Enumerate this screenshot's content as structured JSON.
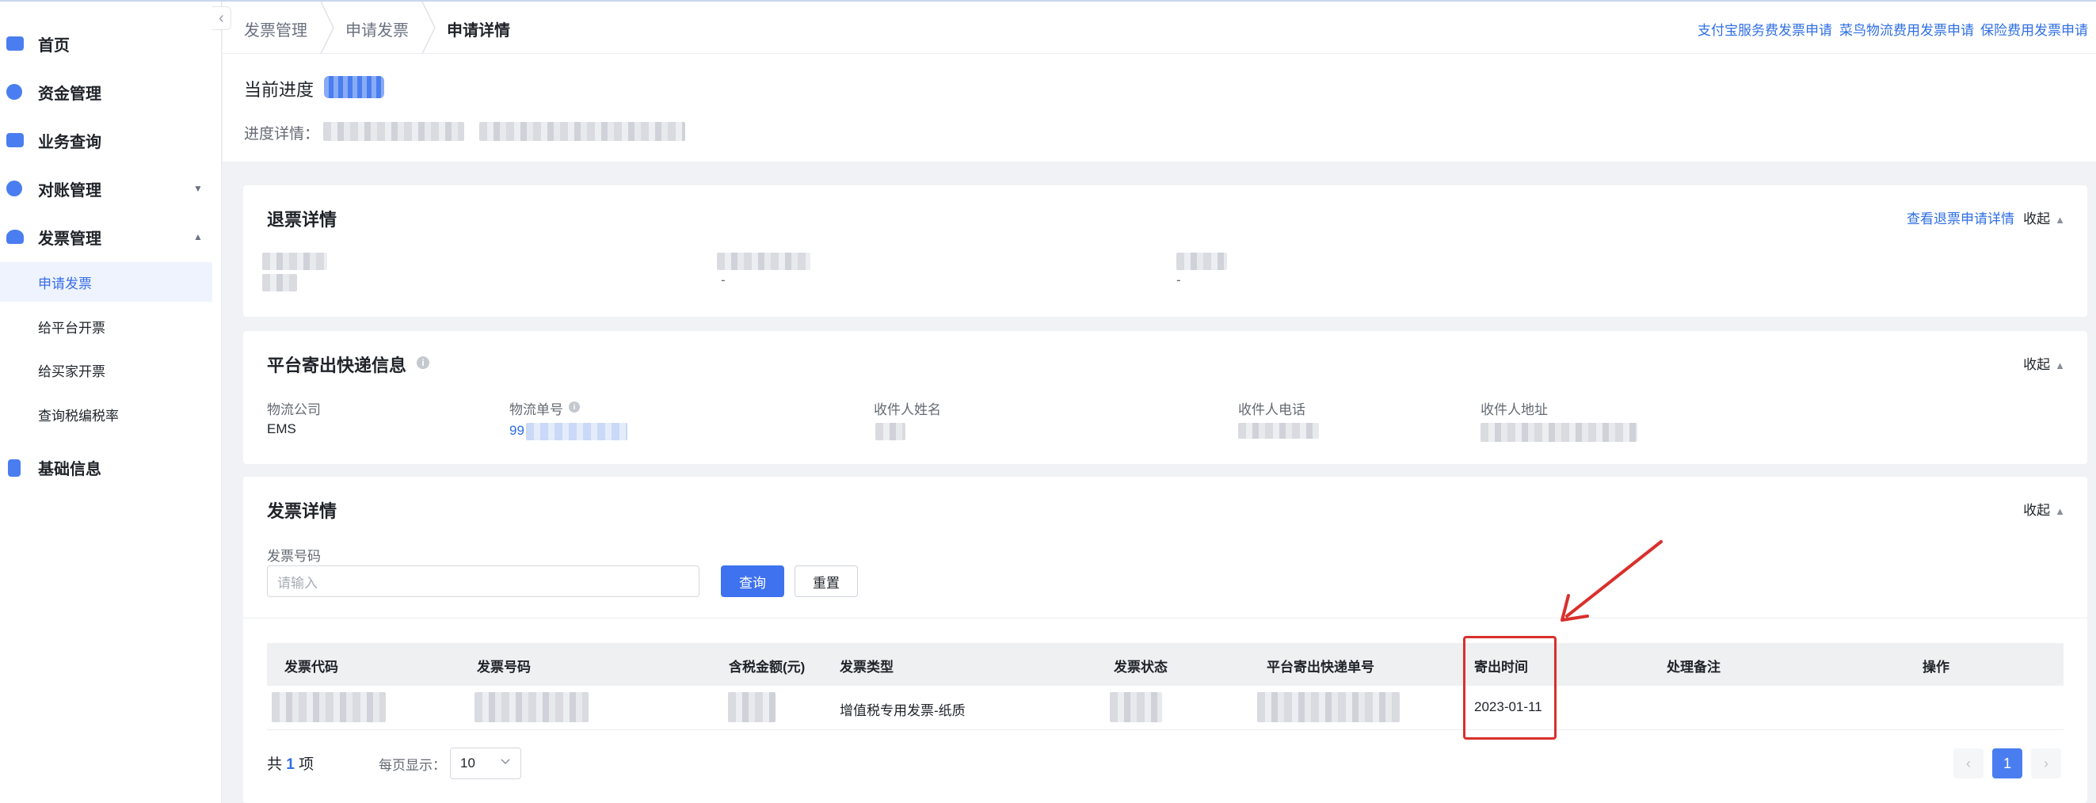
{
  "sidebar": {
    "collapse_glyph": "‹",
    "items": [
      {
        "label": "首页",
        "icon": "home-icon",
        "color": "#4a7ef0"
      },
      {
        "label": "资金管理",
        "icon": "money-icon",
        "color": "#4a7ef0"
      },
      {
        "label": "业务查询",
        "icon": "folder-icon",
        "color": "#4a7ef0"
      },
      {
        "label": "对账管理",
        "icon": "reconcile-icon",
        "color": "#4a7ef0",
        "arrow": "▼"
      },
      {
        "label": "发票管理",
        "icon": "invoice-icon",
        "color": "#4a7ef0",
        "arrow": "▲"
      }
    ],
    "sub_items": [
      "申请发票",
      "给平台开票",
      "给买家开票",
      "查询税编税率"
    ],
    "active_sub": "申请发票",
    "bottom_item": {
      "label": "基础信息",
      "icon": "basic-info-icon",
      "color": "#4a7ef0"
    }
  },
  "header": {
    "breadcrumb": [
      "发票管理",
      "申请发票",
      "申请详情"
    ],
    "links": [
      "支付宝服务费发票申请",
      "菜鸟物流费用发票申请",
      "保险费用发票申请"
    ]
  },
  "progress": {
    "title": "当前进度",
    "detail_label": "进度详情："
  },
  "refund_card": {
    "title": "退票详情",
    "link": "查看退票申请详情",
    "toggle": "收起",
    "toggle_icon": "▲",
    "dash": "-"
  },
  "shipping_card": {
    "title": "平台寄出快递信息",
    "toggle": "收起",
    "toggle_icon": "▲",
    "info_glyph": "i",
    "fields": {
      "company_label": "物流公司",
      "company_value": "EMS",
      "tracking_label": "物流单号",
      "tracking_prefix": "99",
      "recipient_label": "收件人姓名",
      "phone_label": "收件人电话",
      "address_label": "收件人地址"
    }
  },
  "invoice_card": {
    "title": "发票详情",
    "toggle": "收起",
    "toggle_icon": "▲",
    "form": {
      "label": "发票号码",
      "placeholder": "请输入",
      "query_button": "查询",
      "reset_button": "重置"
    },
    "table": {
      "columns": [
        "发票代码",
        "发票号码",
        "含税金额(元)",
        "发票类型",
        "发票状态",
        "平台寄出快递单号",
        "寄出时间",
        "处理备注",
        "操作"
      ],
      "rows": [
        {
          "invoice_type": "增值税专用发票-纸质",
          "ship_date": "2023-01-11"
        }
      ]
    },
    "pagination": {
      "total_prefix": "共",
      "total_count": "1",
      "total_suffix": "项",
      "per_page_label": "每页显示：",
      "per_page_value": "10",
      "prev_glyph": "‹",
      "current_page": "1",
      "next_glyph": "›"
    }
  },
  "colors": {
    "primary": "#3f72ee",
    "link": "#2f6fe4",
    "annotation": "#d9302c"
  }
}
